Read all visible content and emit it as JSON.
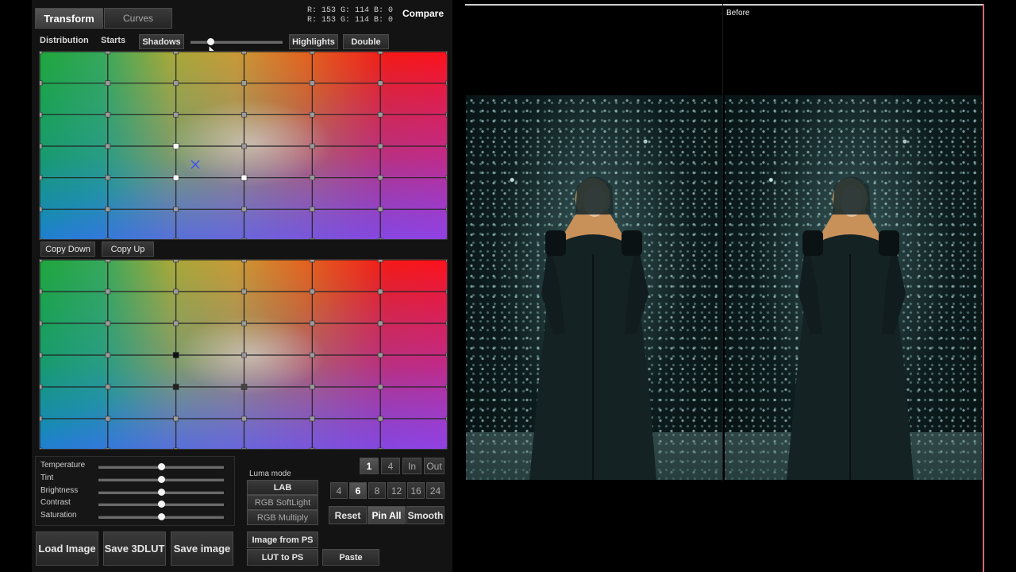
{
  "tabs": {
    "transform": "Transform",
    "curves": "Curves"
  },
  "readout": {
    "line1": "R: 153  G: 114  B:  0",
    "line2": "R: 153  G: 114  B:  0"
  },
  "compare_label": "Compare",
  "before_label": "Before",
  "grid_toolbar": {
    "distribution": "Distribution",
    "starts": "Starts",
    "shadows": "Shadows",
    "highlights": "Highlights",
    "double": "Double",
    "shadows_slider": 0.05
  },
  "copy_buttons": {
    "copy_down": "Copy Down",
    "copy_up": "Copy Up"
  },
  "adjustments": [
    {
      "label": "Temperature",
      "value": 0.5
    },
    {
      "label": "Tint",
      "value": 0.5
    },
    {
      "label": "Brightness",
      "value": 0.5
    },
    {
      "label": "Contrast",
      "value": 0.5
    },
    {
      "label": "Saturation",
      "value": 0.5
    }
  ],
  "luma": {
    "title": "Luma mode",
    "options": [
      "LAB",
      "RGB SoftLight",
      "RGB Multiply"
    ],
    "selected": "LAB"
  },
  "view_buttons": [
    "1",
    "4",
    "In",
    "Out"
  ],
  "grid_size_buttons": [
    "4",
    "6",
    "8",
    "12",
    "16",
    "24"
  ],
  "grid_size_selected": "6",
  "actions": {
    "reset": "Reset",
    "pin_all": "Pin All",
    "smooth": "Smooth"
  },
  "bottom_buttons": {
    "load_image": "Load Image",
    "save_3dlut": "Save 3DLUT",
    "save_image": "Save image",
    "image_from_ps": "Image from PS",
    "lut_to_ps": "LUT to PS",
    "paste": "Paste"
  }
}
